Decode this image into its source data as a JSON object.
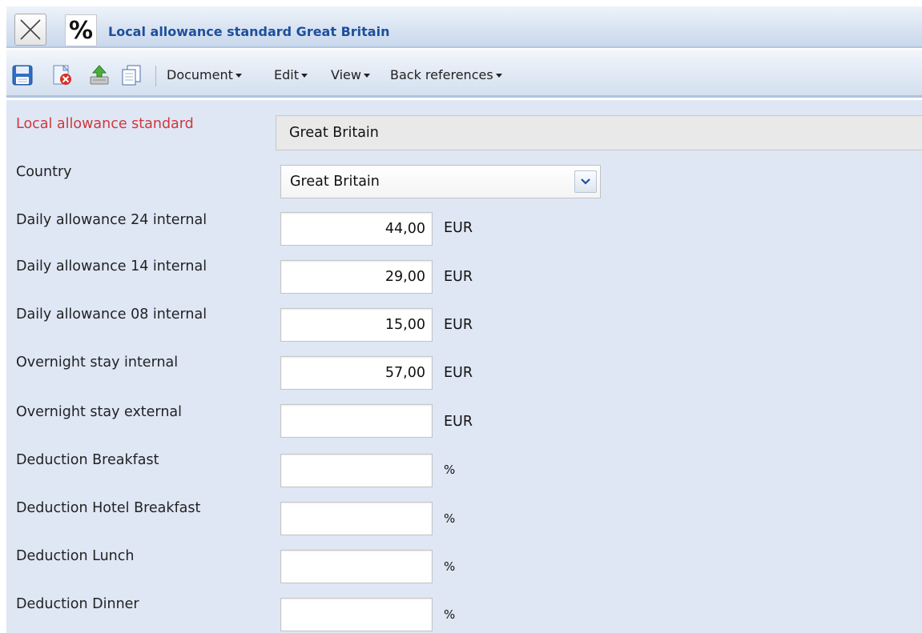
{
  "window": {
    "title": "Local allowance standard Great Britain",
    "close_icon": "close-x-icon",
    "type_icon": "percent-icon",
    "type_glyph": "%"
  },
  "toolbar": {
    "icons": [
      "save-icon",
      "delete-icon",
      "upload-icon",
      "copy-icon"
    ],
    "menus": [
      {
        "label": "Document"
      },
      {
        "label": "Edit"
      },
      {
        "label": "View"
      },
      {
        "label": "Back references"
      }
    ]
  },
  "form": {
    "name": {
      "label": "Local allowance standard",
      "value": "Great Britain"
    },
    "country": {
      "label": "Country",
      "value": "Great Britain"
    },
    "fields": [
      {
        "label": "Daily allowance 24 internal",
        "value": "44,00",
        "unit": "EUR"
      },
      {
        "label": "Daily allowance 14 internal",
        "value": "29,00",
        "unit": "EUR"
      },
      {
        "label": "Daily allowance 08 internal",
        "value": "15,00",
        "unit": "EUR"
      },
      {
        "label": "Overnight stay internal",
        "value": "57,00",
        "unit": "EUR"
      },
      {
        "label": "Overnight stay external",
        "value": "",
        "unit": "EUR"
      },
      {
        "label": "Deduction Breakfast",
        "value": "",
        "unit": "%"
      },
      {
        "label": "Deduction Hotel Breakfast",
        "value": "",
        "unit": "%"
      },
      {
        "label": "Deduction Lunch",
        "value": "",
        "unit": "%"
      },
      {
        "label": "Deduction Dinner",
        "value": "",
        "unit": "%"
      }
    ]
  },
  "colors": {
    "title_text": "#1d4f9c",
    "required_label": "#d0373c",
    "form_background": "#dfe7f5"
  }
}
